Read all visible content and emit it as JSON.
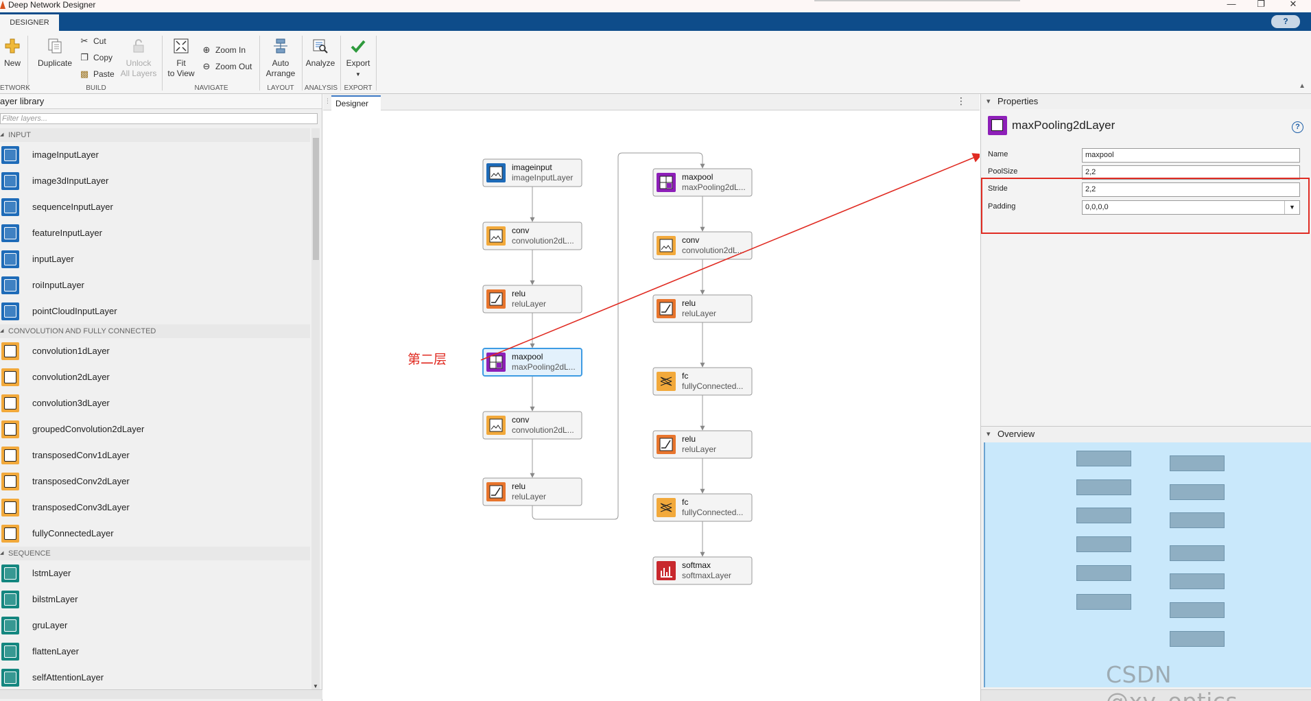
{
  "window": {
    "title": "Deep Network Designer"
  },
  "tabstrip": {
    "tab_label": "DESIGNER",
    "help": "?"
  },
  "toolstrip": {
    "new": "New",
    "duplicate": "Duplicate",
    "cut": "Cut",
    "copy": "Copy",
    "paste": "Paste",
    "unlock": "Unlock",
    "unlock2": "All Layers",
    "fit": "Fit",
    "fit2": "to View",
    "zoom_in": "Zoom In",
    "zoom_out": "Zoom Out",
    "auto": "Auto",
    "auto2": "Arrange",
    "analyze": "Analyze",
    "export": "Export",
    "groups": {
      "network": "ETWORK",
      "build": "BUILD",
      "navigate": "NAVIGATE",
      "layout": "LAYOUT",
      "analysis": "ANALYSIS",
      "export": "EXPORT"
    }
  },
  "library": {
    "title": "ayer library",
    "filter_placeholder": "Filter layers...",
    "categories": [
      {
        "name": "INPUT",
        "color": "blue",
        "items": [
          "imageInputLayer",
          "image3dInputLayer",
          "sequenceInputLayer",
          "featureInputLayer",
          "inputLayer",
          "roiInputLayer",
          "pointCloudInputLayer"
        ]
      },
      {
        "name": "CONVOLUTION AND FULLY CONNECTED",
        "color": "orange",
        "items": [
          "convolution1dLayer",
          "convolution2dLayer",
          "convolution3dLayer",
          "groupedConvolution2dLayer",
          "transposedConv1dLayer",
          "transposedConv2dLayer",
          "transposedConv3dLayer",
          "fullyConnectedLayer"
        ]
      },
      {
        "name": "SEQUENCE",
        "color": "teal",
        "items": [
          "lstmLayer",
          "bilstmLayer",
          "gruLayer",
          "flattenLayer",
          "selfAttentionLayer"
        ]
      }
    ]
  },
  "designer": {
    "tab": "Designer",
    "menu": "⋮",
    "annotation": "第二层",
    "nodes_col1": [
      {
        "name": "imageinput",
        "type": "imageInputLayer",
        "icon": "input",
        "color": "#1e6bb8"
      },
      {
        "name": "conv",
        "type": "convolution2dL...",
        "icon": "conv",
        "color": "#f2a93b"
      },
      {
        "name": "relu",
        "type": "reluLayer",
        "icon": "relu",
        "color": "#e8752d"
      },
      {
        "name": "maxpool",
        "type": "maxPooling2dL...",
        "icon": "pool",
        "color": "#8d1fb8",
        "selected": true
      },
      {
        "name": "conv",
        "type": "convolution2dL...",
        "icon": "conv",
        "color": "#f2a93b"
      },
      {
        "name": "relu",
        "type": "reluLayer",
        "icon": "relu",
        "color": "#e8752d"
      }
    ],
    "nodes_col2": [
      {
        "name": "maxpool",
        "type": "maxPooling2dL...",
        "icon": "pool",
        "color": "#8d1fb8"
      },
      {
        "name": "conv",
        "type": "convolution2dL...",
        "icon": "conv",
        "color": "#f2a93b"
      },
      {
        "name": "relu",
        "type": "reluLayer",
        "icon": "relu",
        "color": "#e8752d"
      },
      {
        "name": "fc",
        "type": "fullyConnected...",
        "icon": "fc",
        "color": "#f2a93b"
      },
      {
        "name": "relu",
        "type": "reluLayer",
        "icon": "relu",
        "color": "#e8752d"
      },
      {
        "name": "fc",
        "type": "fullyConnected...",
        "icon": "fc",
        "color": "#f2a93b"
      },
      {
        "name": "softmax",
        "type": "softmaxLayer",
        "icon": "softmax",
        "color": "#c8282d"
      }
    ]
  },
  "properties": {
    "header": "Properties",
    "layer_type": "maxPooling2dLayer",
    "help": "?",
    "fields": [
      {
        "label": "Name",
        "value": "maxpool"
      },
      {
        "label": "PoolSize",
        "value": "2,2"
      },
      {
        "label": "Stride",
        "value": "2,2"
      },
      {
        "label": "Padding",
        "value": "0,0,0,0"
      }
    ]
  },
  "overview": {
    "header": "Overview"
  },
  "watermark": "CSDN @xy_optics"
}
